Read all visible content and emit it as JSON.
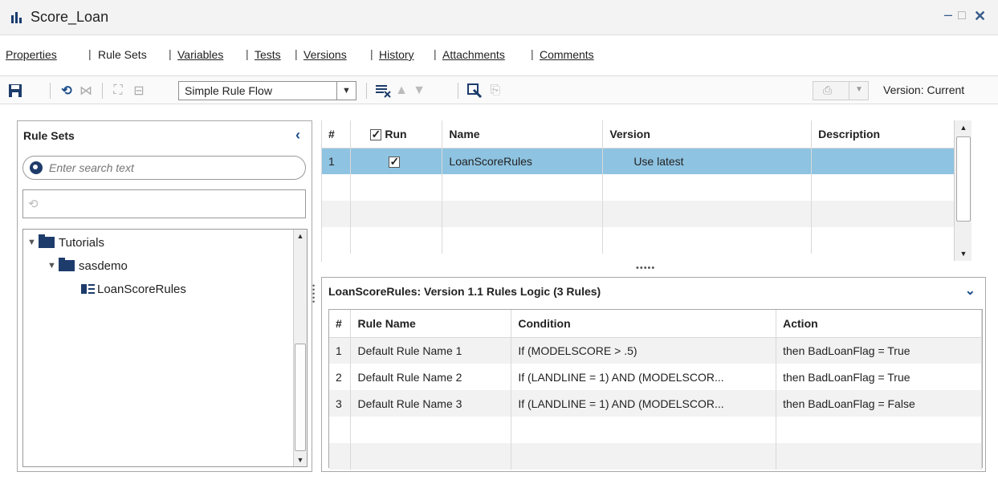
{
  "window": {
    "title": "Score_Loan",
    "minimize": "–",
    "maximize": "□",
    "close": "✕"
  },
  "tabs": [
    {
      "label": "Properties",
      "active": false
    },
    {
      "label": "Rule Sets",
      "active": true
    },
    {
      "label": "Variables",
      "active": false
    },
    {
      "label": "Tests",
      "active": false
    },
    {
      "label": "Versions",
      "active": false
    },
    {
      "label": "History",
      "active": false
    },
    {
      "label": "Attachments",
      "active": false
    },
    {
      "label": "Comments",
      "active": false
    }
  ],
  "toolbar": {
    "flow_type": "Simple Rule Flow",
    "version_label": "Version: Current"
  },
  "left_panel": {
    "title": "Rule Sets",
    "search_placeholder": "Enter search text",
    "tree": [
      {
        "label": "Tutorials",
        "type": "folder"
      },
      {
        "label": "sasdemo",
        "type": "folder"
      },
      {
        "label": "LoanScoreRules",
        "type": "ruleset"
      }
    ]
  },
  "rule_sets_table": {
    "headers": {
      "num": "#",
      "run": "Run",
      "name": "Name",
      "version": "Version",
      "description": "Description"
    },
    "rows": [
      {
        "num": "1",
        "run": true,
        "name": "LoanScoreRules",
        "version": "Use latest",
        "description": ""
      }
    ]
  },
  "logic_panel": {
    "title": "LoanScoreRules: Version 1.1 Rules Logic (3 Rules)",
    "headers": {
      "num": "#",
      "rule_name": "Rule Name",
      "condition": "Condition",
      "action": "Action"
    },
    "rows": [
      {
        "num": "1",
        "rule_name": "Default Rule Name 1",
        "condition": "If (MODELSCORE > .5)",
        "action": "then BadLoanFlag = True"
      },
      {
        "num": "2",
        "rule_name": "Default Rule Name 2",
        "condition": "If (LANDLINE = 1) AND (MODELSCOR...",
        "action": "then BadLoanFlag = True"
      },
      {
        "num": "3",
        "rule_name": "Default Rule Name 3",
        "condition": "If (LANDLINE = 1) AND (MODELSCOR...",
        "action": "then BadLoanFlag = False"
      }
    ]
  },
  "colors": {
    "selection": "#8ec3e1",
    "accent": "#1d4f8c",
    "alt_row": "#f2f2f2"
  }
}
